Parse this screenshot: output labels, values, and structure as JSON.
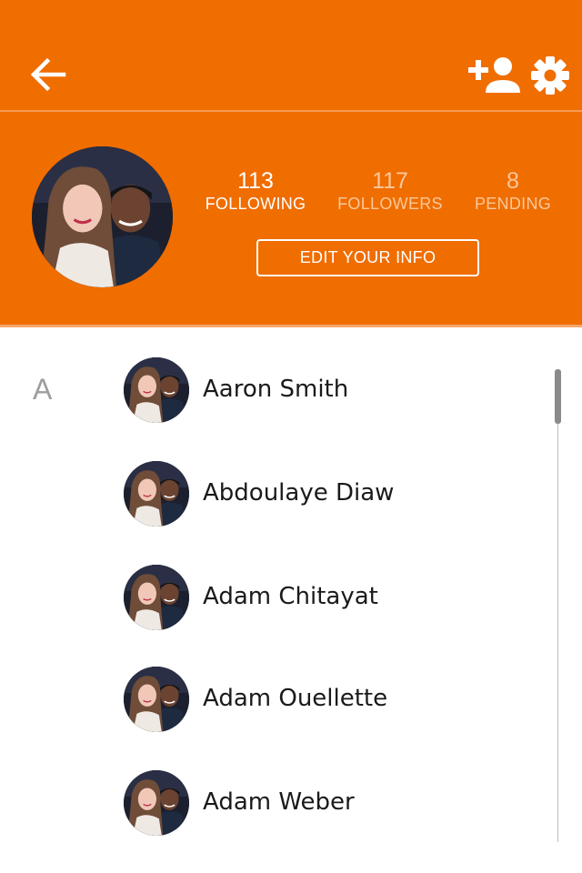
{
  "header": {
    "back_icon": "arrow-left-icon",
    "add_person_icon": "add-person-icon",
    "settings_icon": "gear-icon",
    "background_color": "#f06d00"
  },
  "profile": {
    "avatar_icon": "couple-photo",
    "stats": {
      "following": {
        "value": "113",
        "label": "FOLLOWING"
      },
      "followers": {
        "value": "117",
        "label": "FOLLOWERS"
      },
      "pending": {
        "value": "8",
        "label": "PENDING"
      }
    },
    "edit_button_label": "EDIT YOUR INFO"
  },
  "contacts": {
    "section_letter": "A",
    "items": [
      {
        "name": "Aaron Smith"
      },
      {
        "name": "Abdoulaye Diaw"
      },
      {
        "name": "Adam Chitayat"
      },
      {
        "name": "Adam Ouellette"
      },
      {
        "name": "Adam Weber"
      }
    ]
  }
}
